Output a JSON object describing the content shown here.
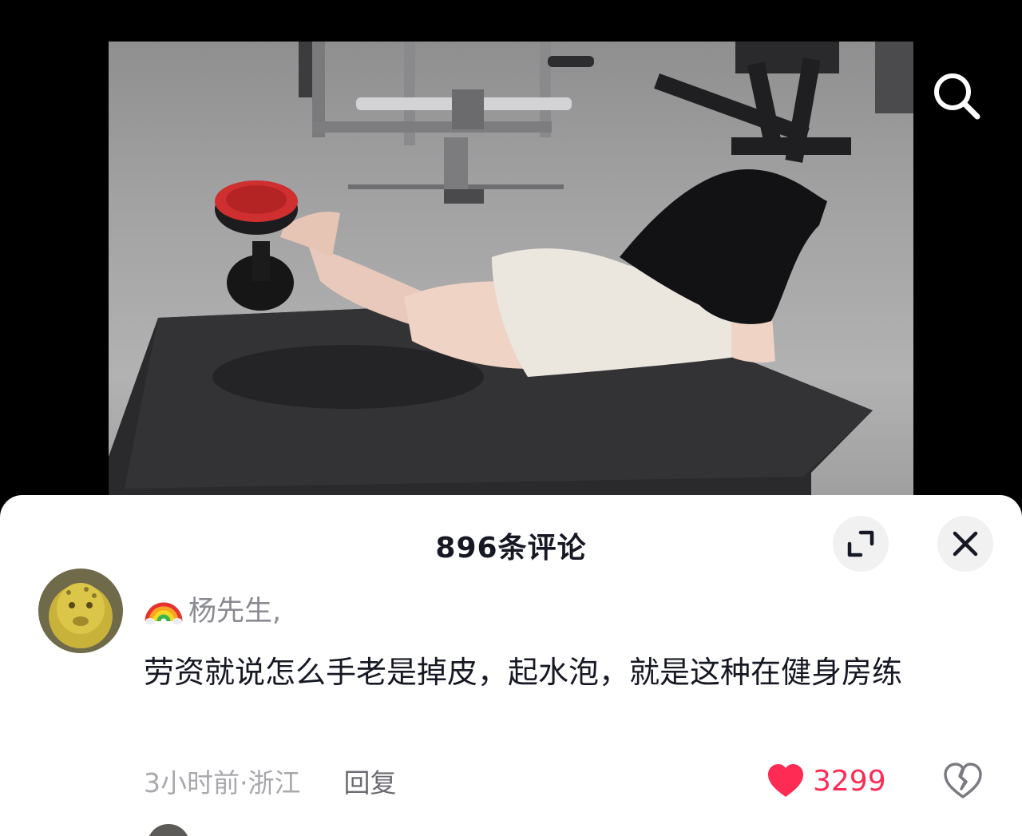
{
  "video": {
    "search_icon": "search-icon"
  },
  "comments_panel": {
    "title": "896条评论",
    "expand_icon": "expand-icon",
    "close_icon": "close-icon"
  },
  "comment": {
    "username_emoji": "🌈",
    "username": "杨先生,",
    "text": "劳资就说怎么手老是掉皮，起水泡，就是这种在健身房练",
    "time_location": "3小时前·浙江",
    "reply_label": "回复",
    "like_count": "3299",
    "liked": true,
    "like_color": "#fe2c55",
    "dislike_icon": "broken-heart-icon"
  }
}
